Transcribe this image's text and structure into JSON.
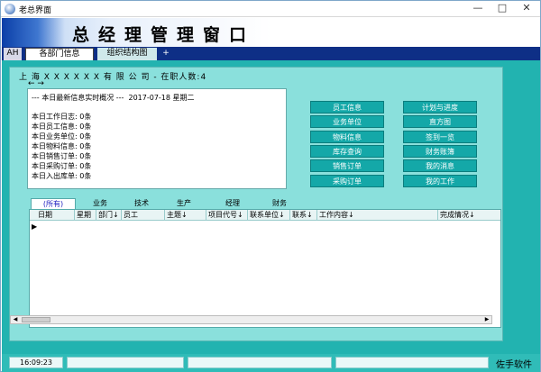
{
  "window": {
    "title": "老总界面",
    "controls": {
      "minimize": "—",
      "maximize": "□",
      "close": "✕"
    }
  },
  "banner": {
    "title": "总经理管理窗口"
  },
  "top_tabs": [
    {
      "label": "AH"
    },
    {
      "label": "各部门信息"
    },
    {
      "label": "组织结构图"
    },
    {
      "label": "+"
    }
  ],
  "company_line": "上 海 X X X X X X 有 限 公 司 - 在职人数:4",
  "nav_arrows": "← →",
  "summary": {
    "header": "--- 本日最新信息实时概况 ---  2017-07-18 星期二",
    "lines": [
      "本日工作日志: 0条",
      "本日员工信息: 0条",
      "本日业务单位: 0条",
      "本日物料信息: 0条",
      "本日销售订单: 0条",
      "本日采购订单: 0条",
      "本日入出库单: 0条"
    ]
  },
  "function_buttons": {
    "left": [
      "员工信息",
      "业务单位",
      "物料信息",
      "库存查询",
      "销售订单",
      "采购订单"
    ],
    "right": [
      "计划与进度",
      "直方图",
      "签到一览",
      "财务账簿",
      "我的消息",
      "我的工作"
    ]
  },
  "dept_tabs": [
    "(所有)",
    "业务",
    "技术",
    "生产",
    "经理",
    "财务"
  ],
  "grid": {
    "columns": [
      "日期",
      "星期",
      "部门↓",
      "员工",
      "主题↓",
      "项目代号↓",
      "联系单位↓",
      "联系↓",
      "工作内容↓",
      "完成情况↓"
    ]
  },
  "grid_row_indicator": "▶",
  "status": {
    "time": "16:09:23",
    "brand": "佐手软件"
  }
}
